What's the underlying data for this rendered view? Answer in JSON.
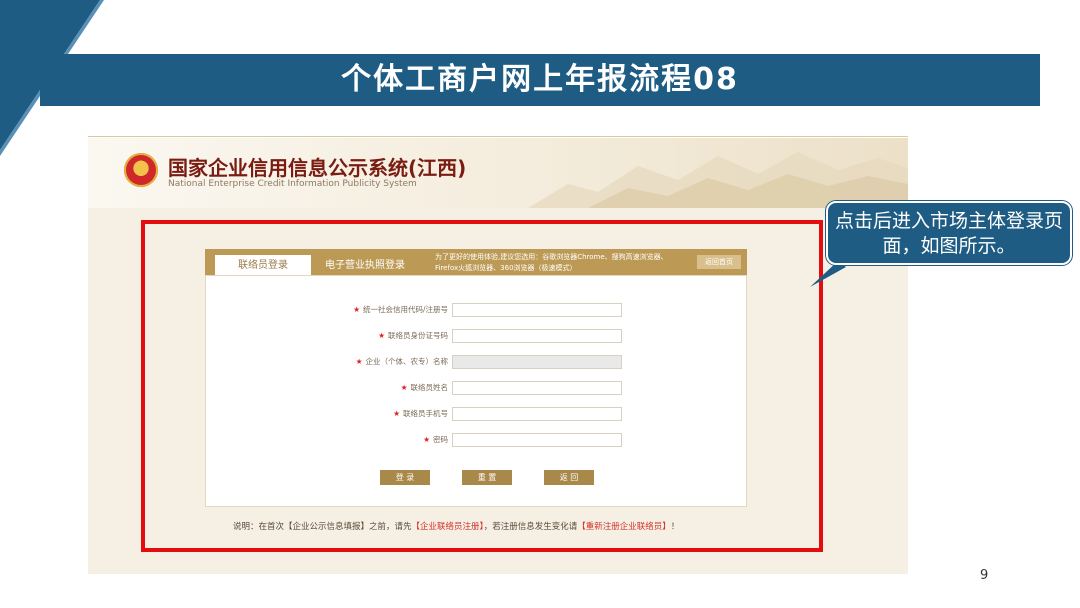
{
  "slide": {
    "title": "个体工商户网上年报流程08",
    "page_number": "9",
    "callout": "点击后进入市场主体登录页面，如图所示。"
  },
  "site": {
    "name_cn": "国家企业信用信息公示系统(江西)",
    "name_en": "National Enterprise Credit Information Publicity System"
  },
  "tabs": {
    "liaison_login": "联络员登录",
    "license_login": "电子营业执照登录"
  },
  "tip": "为了更好的使用体验,建议您选用：谷歌浏览器Chrome、搜狗高速浏览器、Firefox火狐浏览器、360浏览器（极速模式）",
  "back_home": "返回首页",
  "form": {
    "fields": [
      {
        "label": "统一社会信用代码/注册号",
        "value": ""
      },
      {
        "label": "联络员身份证号码",
        "value": ""
      },
      {
        "label": "企业（个体、农专）名称",
        "value": ""
      },
      {
        "label": "联络员姓名",
        "value": ""
      },
      {
        "label": "联络员手机号",
        "value": ""
      },
      {
        "label": "密码",
        "value": ""
      }
    ],
    "buttons": {
      "login": "登 录",
      "reset": "重 置",
      "back": "返 回"
    }
  },
  "note": {
    "prefix": "说明：在首次【企业公示信息填报】之前，请先",
    "link1": "【企业联络员注册】",
    "middle": "，若注册信息发生变化请",
    "link2": "【重新注册企业联络员】",
    "suffix": "！"
  },
  "colors": {
    "title_bar": "#1f5c84",
    "highlight_frame": "#e30d10",
    "panel_tab": "#bc9a55",
    "button": "#a9894a"
  }
}
